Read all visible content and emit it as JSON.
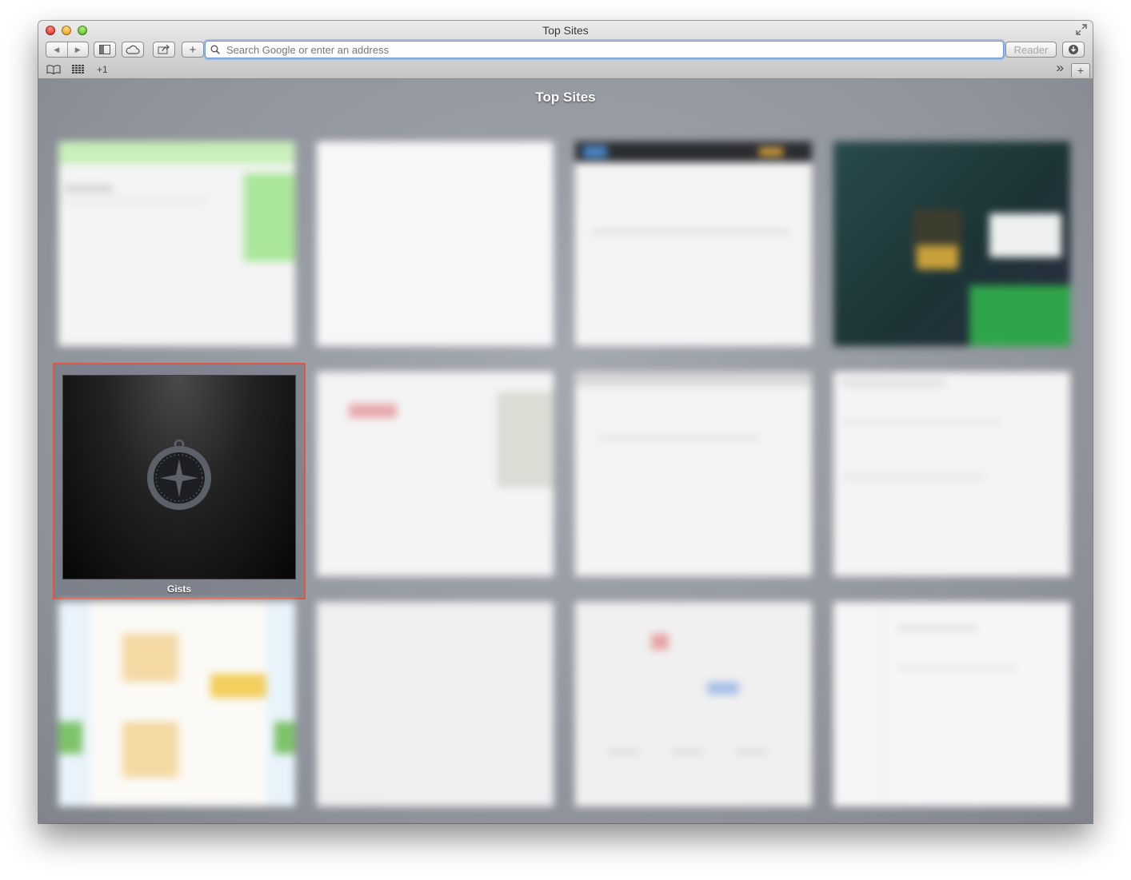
{
  "window": {
    "title": "Top Sites"
  },
  "toolbar": {
    "back_icon": "◀",
    "forward_icon": "▶",
    "new_tab_plus": "+",
    "reader_label": "Reader",
    "address_placeholder": "Search Google or enter an address"
  },
  "bookmarks_bar": {
    "reading_list_icon": "book-icon",
    "top_sites_icon": "grid-icon",
    "overflow_count": "+1",
    "overflow_chevron": "»",
    "add_tab": "+"
  },
  "top_sites": {
    "heading": "Top Sites",
    "focused_tile": {
      "label": "Gists",
      "icon": "compass-icon"
    }
  },
  "colors": {
    "focus_border": "#e2553f",
    "address_focus": "#6e9ad6"
  }
}
